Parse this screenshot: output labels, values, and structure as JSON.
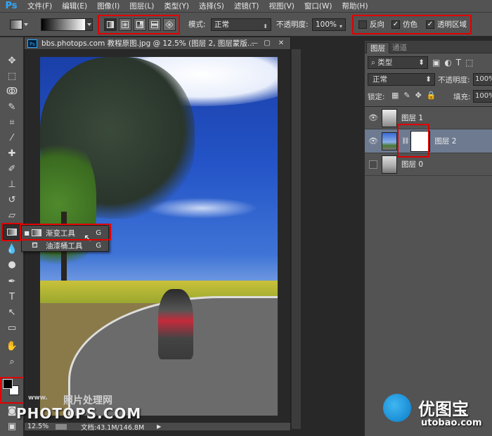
{
  "app": {
    "logo": "Ps",
    "menu": [
      "文件(F)",
      "编辑(E)",
      "图像(I)",
      "图层(L)",
      "类型(Y)",
      "选择(S)",
      "滤镜(T)",
      "视图(V)",
      "窗口(W)",
      "帮助(H)"
    ]
  },
  "options": {
    "mode_label": "模式:",
    "mode_value": "正常",
    "opacity_label": "不透明度:",
    "opacity_value": "100%",
    "reverse_label": "反向",
    "dither_label": "仿色",
    "transparency_label": "透明区域",
    "reverse_checked": false,
    "dither_checked": true,
    "transparency_checked": true
  },
  "document": {
    "title": "bbs.photops.com 教程原图.jpg @ 12.5% (图层 2, 图层蒙版...",
    "zoom": "12.5%",
    "doc_info": "文档:43.1M/146.8M"
  },
  "flyout": {
    "items": [
      {
        "label": "渐变工具",
        "key": "G",
        "icon": "gradient-icon",
        "selected": true
      },
      {
        "label": "油漆桶工具",
        "key": "G",
        "icon": "paint-bucket-icon",
        "selected": false
      }
    ]
  },
  "layers_panel": {
    "tabs": [
      "图层",
      "通道"
    ],
    "filter_value": "类型",
    "blend_mode": "正常",
    "opacity_label": "不透明度:",
    "opacity_value": "100%",
    "lock_label": "锁定:",
    "fill_label": "填充:",
    "fill_value": "100%",
    "layers": [
      {
        "name": "图层 1",
        "visible": true,
        "selected": false
      },
      {
        "name": "图层 2",
        "visible": true,
        "selected": true
      },
      {
        "name": "图层 0",
        "visible": false,
        "selected": false
      }
    ]
  },
  "watermark": {
    "cn_text": "照片处理网",
    "site": "PHOTOPS.COM",
    "brand_cn": "优图宝",
    "brand_url": "utobao.com",
    "www": "www."
  },
  "colors": {
    "highlight": "#e00000",
    "accent": "#31a8ff"
  }
}
